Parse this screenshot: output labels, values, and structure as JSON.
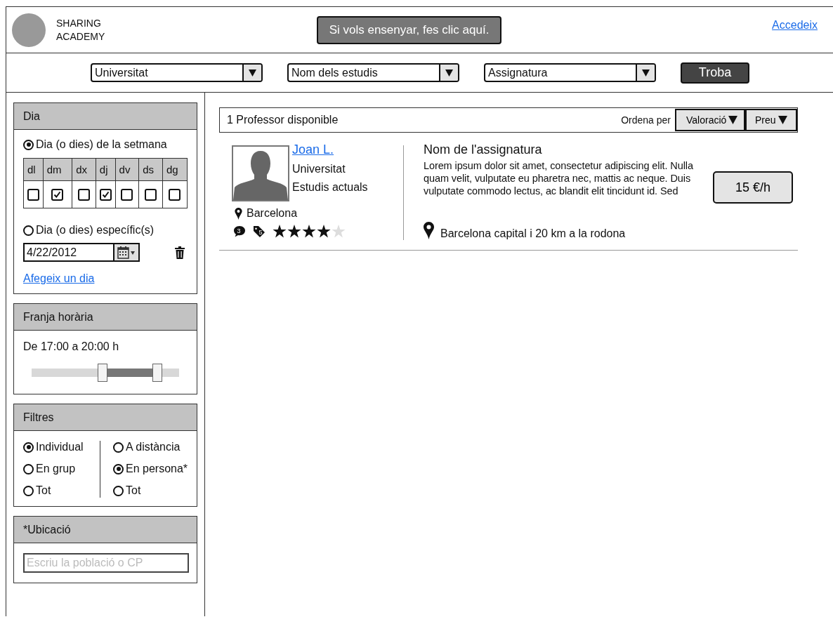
{
  "header": {
    "logo_text": "SHARING ACADEMY",
    "teach_button": "Si vols ensenyar, fes clic aquí.",
    "login_link": "Accedeix"
  },
  "search_bar": {
    "dropdowns": [
      {
        "value": "Universitat"
      },
      {
        "value": "Nom dels estudis"
      },
      {
        "value": "Assignatura"
      }
    ],
    "search_button": "Troba"
  },
  "sidebar": {
    "day_panel": {
      "title": "Dia",
      "modes": [
        {
          "label": "Dia (o dies) de la setmana",
          "selected": true
        },
        {
          "label": "Dia (o dies) específic(s)",
          "selected": false
        }
      ],
      "weekdays": [
        {
          "label": "dl",
          "checked": false
        },
        {
          "label": "dm",
          "checked": true
        },
        {
          "label": "dx",
          "checked": false
        },
        {
          "label": "dj",
          "checked": true
        },
        {
          "label": "dv",
          "checked": false
        },
        {
          "label": "ds",
          "checked": false
        },
        {
          "label": "dg",
          "checked": false
        }
      ],
      "date_field": {
        "value": "4/22/2012"
      },
      "add_link": "Afegeix un dia"
    },
    "time_panel": {
      "title": "Franja horària",
      "range_text": "De 17:00 a 20:00 h",
      "slider": {
        "thumbs": [
          {
            "level": 0.48
          },
          {
            "level": 0.85
          }
        ]
      }
    },
    "filters_panel": {
      "title": "Filtres",
      "columns": [
        [
          {
            "label": "Individual",
            "selected": true
          },
          {
            "label": "En grup",
            "selected": false
          },
          {
            "label": "Tot",
            "selected": false
          }
        ],
        [
          {
            "label": "A distància",
            "selected": false
          },
          {
            "label": "En persona*",
            "selected": true
          },
          {
            "label": "Tot",
            "selected": false
          }
        ]
      ]
    },
    "location_panel": {
      "title": "*Ubicació",
      "field": {
        "placeholder": "Escriu la població o CP"
      }
    }
  },
  "results": {
    "count_text": "1 Professor disponible",
    "sort_label": "Ordena per",
    "sort_buttons": [
      "Valoració",
      "Preu"
    ],
    "items": [
      {
        "name": "Joan L.",
        "university": "Universitat",
        "studies": "Estudis actuals",
        "city": "Barcelona",
        "comments": "3",
        "tags": "5",
        "stars": 4,
        "subject": "Nom de l'assignatura",
        "description": "Lorem ipsum dolor sit amet, consectetur adipiscing elit. Nulla quam velit, vulputate eu pharetra nec, mattis ac neque. Duis vulputate commodo lectus, ac blandit elit tincidunt id. Sed",
        "price": "15 €/h",
        "area": "Barcelona capital i 20 km a la rodona"
      }
    ]
  }
}
